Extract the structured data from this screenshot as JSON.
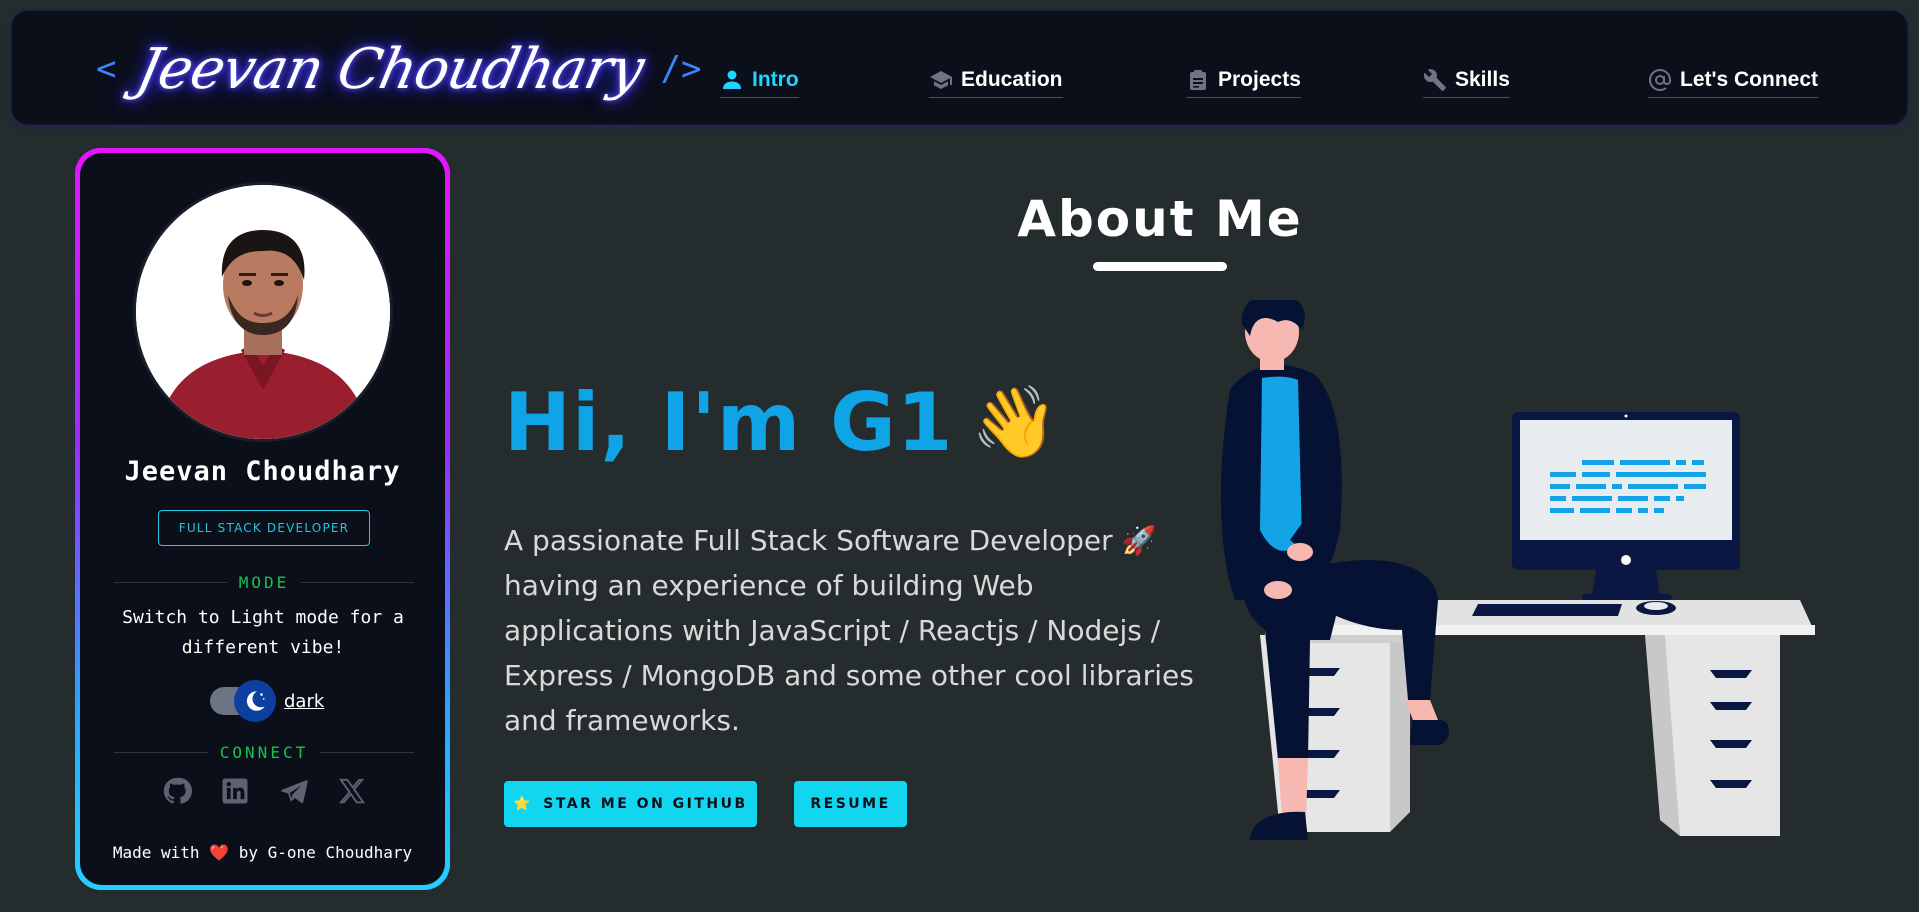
{
  "navbar": {
    "brand_left_bracket": "<",
    "brand_signature": "Jeevan Choudhary",
    "brand_right_bracket": "/>",
    "links": [
      {
        "label": "Intro",
        "icon": "person-icon",
        "active": true
      },
      {
        "label": "Education",
        "icon": "graduation-cap-icon",
        "active": false
      },
      {
        "label": "Projects",
        "icon": "clipboard-icon",
        "active": false
      },
      {
        "label": "Skills",
        "icon": "wrench-icon",
        "active": false
      },
      {
        "label": "Let's Connect",
        "icon": "at-sign-icon",
        "active": false
      }
    ]
  },
  "profile": {
    "name": "Jeevan Choudhary",
    "role": "FULL STACK DEVELOPER",
    "mode_heading": "MODE",
    "mode_text": "Switch to Light mode for a different vibe!",
    "toggle_label": "dark",
    "toggle_icon": "moon-icon",
    "connect_heading": "CONNECT",
    "social": [
      "github-icon",
      "linkedin-icon",
      "telegram-icon",
      "x-icon"
    ],
    "footer_prefix": "Made with",
    "footer_heart": "❤️",
    "footer_suffix": "by G-one Choudhary"
  },
  "main": {
    "section_title": "About Me",
    "greeting": "Hi, I'm G1",
    "greeting_emoji": "👋",
    "bio": "A passionate Full Stack Software Developer 🚀 having an experience of building Web applications with JavaScript / Reactjs / Nodejs / Express / MongoDB and some other cool libraries and frameworks.",
    "buttons": {
      "github_emoji": "⭐",
      "github_label": "STAR ME ON GITHUB",
      "resume_label": "RESUME"
    }
  },
  "colors": {
    "accent": "#21d4fd",
    "greeting": "#0fa4e6",
    "button_bg": "#12d5f0",
    "mode_heading": "#18c24a",
    "background": "#252c2e",
    "panel": "#0b0f19"
  }
}
